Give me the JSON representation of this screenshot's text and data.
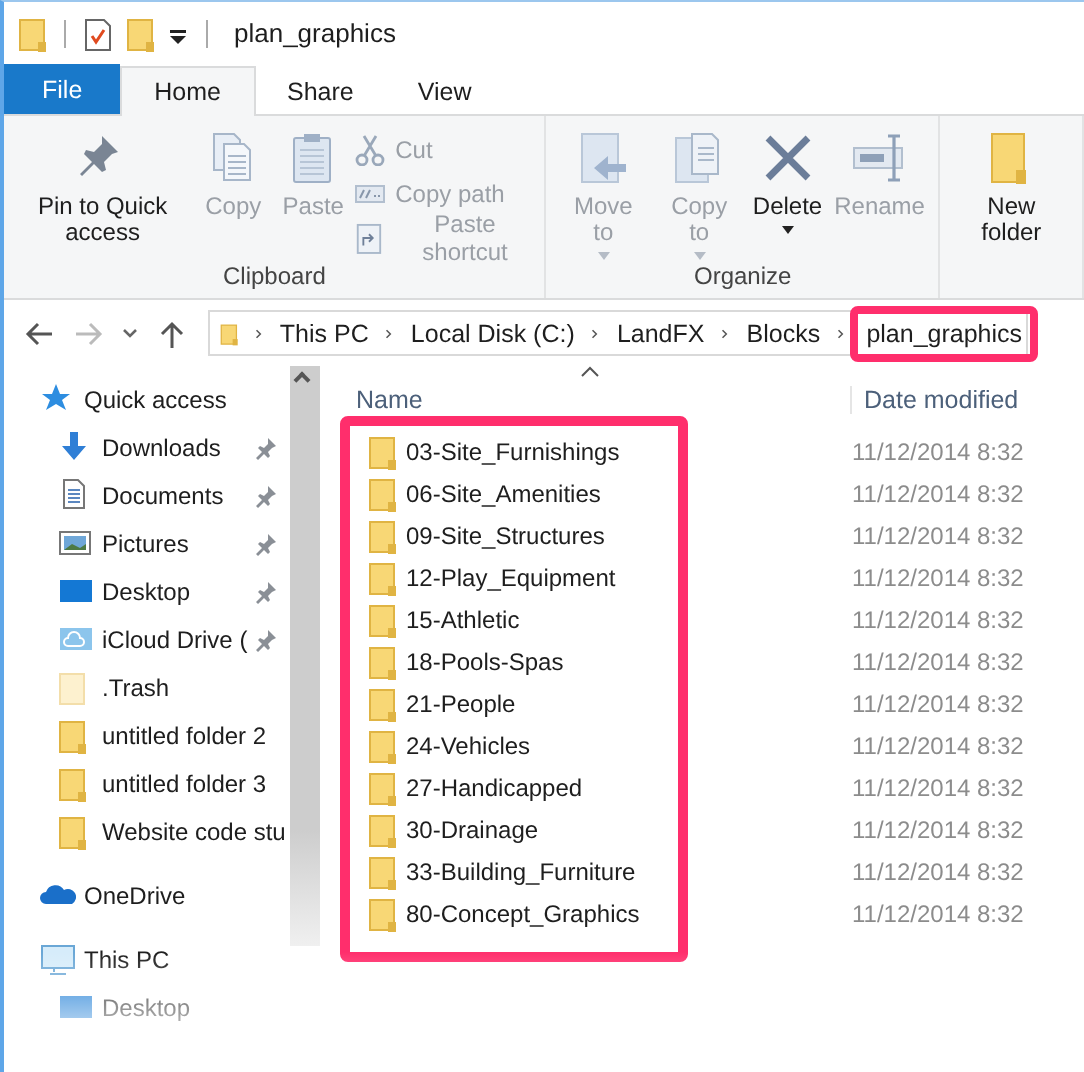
{
  "window": {
    "title": "plan_graphics"
  },
  "tabs": [
    {
      "label": "File",
      "kind": "file",
      "selected": false
    },
    {
      "label": "Home",
      "kind": "tab",
      "selected": true
    },
    {
      "label": "Share",
      "kind": "tab",
      "selected": false
    },
    {
      "label": "View",
      "kind": "tab",
      "selected": false
    }
  ],
  "ribbon": {
    "groups": [
      {
        "label": "Clipboard",
        "large": [
          {
            "label": "Pin to Quick access",
            "kind": "pin",
            "disabled": false
          },
          {
            "label": "Copy",
            "kind": "copy",
            "disabled": true
          },
          {
            "label": "Paste",
            "kind": "paste",
            "disabled": true
          }
        ],
        "small": [
          {
            "label": "Cut",
            "kind": "scissors",
            "disabled": true
          },
          {
            "label": "Copy path",
            "kind": "path",
            "disabled": true
          },
          {
            "label": "Paste shortcut",
            "kind": "shortcut",
            "disabled": true
          }
        ]
      },
      {
        "label": "Organize",
        "large": [
          {
            "label": "Move to",
            "kind": "move",
            "disabled": true,
            "dropdown": true
          },
          {
            "label": "Copy to",
            "kind": "copyto",
            "disabled": true,
            "dropdown": true
          },
          {
            "label": "Delete",
            "kind": "delete",
            "disabled": false,
            "dropdown": true
          },
          {
            "label": "Rename",
            "kind": "rename",
            "disabled": true
          }
        ]
      },
      {
        "large": [
          {
            "label": "New folder",
            "kind": "folder",
            "disabled": false
          }
        ]
      }
    ]
  },
  "address": {
    "crumbs": [
      {
        "label": "This PC",
        "highlighted": false
      },
      {
        "label": "Local Disk (C:)",
        "highlighted": false
      },
      {
        "label": "LandFX",
        "highlighted": false
      },
      {
        "label": "Blocks",
        "highlighted": false
      },
      {
        "label": "plan_graphics",
        "highlighted": true
      }
    ]
  },
  "sidebar": {
    "items": [
      {
        "label": "Quick access",
        "kind": "star",
        "pinned": false
      },
      {
        "label": "Downloads",
        "kind": "download",
        "pinned": true
      },
      {
        "label": "Documents",
        "kind": "document",
        "pinned": true
      },
      {
        "label": "Pictures",
        "kind": "picture",
        "pinned": true
      },
      {
        "label": "Desktop",
        "kind": "desktop",
        "pinned": true
      },
      {
        "label": "iCloud Drive (",
        "kind": "cloud",
        "pinned": true
      },
      {
        "label": ".Trash",
        "kind": "hidden-folder",
        "pinned": false
      },
      {
        "label": "untitled folder 2",
        "kind": "folder",
        "pinned": false
      },
      {
        "label": "untitled folder 3",
        "kind": "folder",
        "pinned": false
      },
      {
        "label": "Website code stu",
        "kind": "folder",
        "pinned": false
      },
      {
        "label": "OneDrive",
        "kind": "onedrive",
        "pinned": false
      },
      {
        "label": "This PC",
        "kind": "pc",
        "pinned": false
      },
      {
        "label": "Desktop",
        "kind": "desktop",
        "pinned": false
      }
    ]
  },
  "file_list": {
    "columns": [
      "Name",
      "Date modified"
    ],
    "highlighted": true,
    "rows": [
      {
        "name": "03-Site_Furnishings",
        "date": "11/12/2014 8:32"
      },
      {
        "name": "06-Site_Amenities",
        "date": "11/12/2014 8:32"
      },
      {
        "name": "09-Site_Structures",
        "date": "11/12/2014 8:32"
      },
      {
        "name": "12-Play_Equipment",
        "date": "11/12/2014 8:32"
      },
      {
        "name": "15-Athletic",
        "date": "11/12/2014 8:32"
      },
      {
        "name": "18-Pools-Spas",
        "date": "11/12/2014 8:32"
      },
      {
        "name": "21-People",
        "date": "11/12/2014 8:32"
      },
      {
        "name": "24-Vehicles",
        "date": "11/12/2014 8:32"
      },
      {
        "name": "27-Handicapped",
        "date": "11/12/2014 8:32"
      },
      {
        "name": "30-Drainage",
        "date": "11/12/2014 8:32"
      },
      {
        "name": "33-Building_Furniture",
        "date": "11/12/2014 8:32"
      },
      {
        "name": "80-Concept_Graphics",
        "date": "11/12/2014 8:32"
      }
    ]
  }
}
